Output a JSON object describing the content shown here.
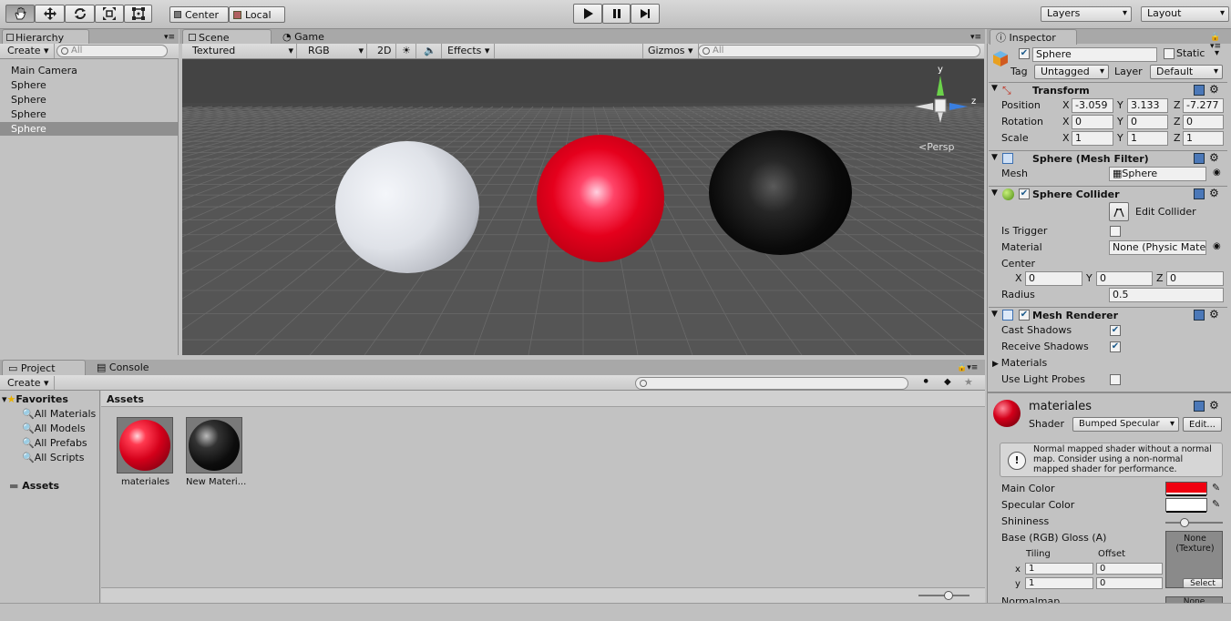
{
  "toolbar": {
    "pivot": "Center",
    "space": "Local",
    "layers": "Layers",
    "layout": "Layout"
  },
  "hierarchy": {
    "tab": "Hierarchy",
    "create": "Create",
    "search_placeholder": "All",
    "items": [
      "Main Camera",
      "Sphere",
      "Sphere",
      "Sphere",
      "Sphere"
    ]
  },
  "scene": {
    "tabs": [
      "Scene",
      "Game"
    ],
    "shading": "Textured",
    "render_mode": "RGB",
    "mode_2d": "2D",
    "effects": "Effects",
    "gizmos": "Gizmos",
    "search_placeholder": "All",
    "persp": "Persp",
    "gizmo_y": "y",
    "gizmo_z": "z"
  },
  "project": {
    "tabs": [
      "Project",
      "Console"
    ],
    "create": "Create",
    "favorites": "Favorites",
    "favorite_items": [
      "All Materials",
      "All Models",
      "All Prefabs",
      "All Scripts"
    ],
    "assets_root": "Assets",
    "breadcrumb": "Assets",
    "assets": [
      {
        "name": "materiales",
        "color": "#d4001a"
      },
      {
        "name": "New Materi...",
        "color": "#111111"
      }
    ]
  },
  "inspector": {
    "tab": "Inspector",
    "object_name": "Sphere",
    "static_label": "Static",
    "tag_label": "Tag",
    "tag_value": "Untagged",
    "layer_label": "Layer",
    "layer_value": "Default",
    "transform": {
      "title": "Transform",
      "position_label": "Position",
      "rotation_label": "Rotation",
      "scale_label": "Scale",
      "position": [
        "-3.059",
        "3.133",
        "-7.277"
      ],
      "rotation": [
        "0",
        "0",
        "0"
      ],
      "scale": [
        "1",
        "1",
        "1"
      ],
      "axes": [
        "X",
        "Y",
        "Z"
      ]
    },
    "mesh_filter": {
      "title": "Sphere (Mesh Filter)",
      "mesh_label": "Mesh",
      "mesh_value": "Sphere"
    },
    "sphere_collider": {
      "title": "Sphere Collider",
      "edit_collider": "Edit Collider",
      "is_trigger": "Is Trigger",
      "material_label": "Material",
      "material_value": "None (Physic Mate",
      "center_label": "Center",
      "center": [
        "0",
        "0",
        "0"
      ],
      "radius_label": "Radius",
      "radius_value": "0.5"
    },
    "mesh_renderer": {
      "title": "Mesh Renderer",
      "cast_shadows": "Cast Shadows",
      "receive_shadows": "Receive Shadows",
      "materials": "Materials",
      "use_light_probes": "Use Light Probes"
    },
    "material": {
      "name": "materiales",
      "shader_label": "Shader",
      "shader_value": "Bumped Specular",
      "edit_btn": "Edit...",
      "help_text": "Normal mapped shader without a normal map. Consider using a non-normal mapped shader for performance.",
      "main_color": "Main Color",
      "specular_color": "Specular Color",
      "shininess": "Shininess",
      "shininess_value": 0.3,
      "base": "Base (RGB) Gloss (A)",
      "tiling": "Tiling",
      "offset": "Offset",
      "tx_label": "x",
      "ty_label": "y",
      "tiling_x": "1",
      "tiling_y": "1",
      "offset_x": "0",
      "offset_y": "0",
      "texture_none": "None\n(Texture)",
      "select": "Select",
      "normalmap": "Normalmap",
      "normalmap_none": "None",
      "main_color_value": "#f00010",
      "specular_color_value": "#ffffff"
    }
  },
  "spheres": [
    {
      "name": "white",
      "color": "#e8eaee"
    },
    {
      "name": "red",
      "color": "#e00018"
    },
    {
      "name": "black",
      "color": "#0a0a0a"
    }
  ]
}
